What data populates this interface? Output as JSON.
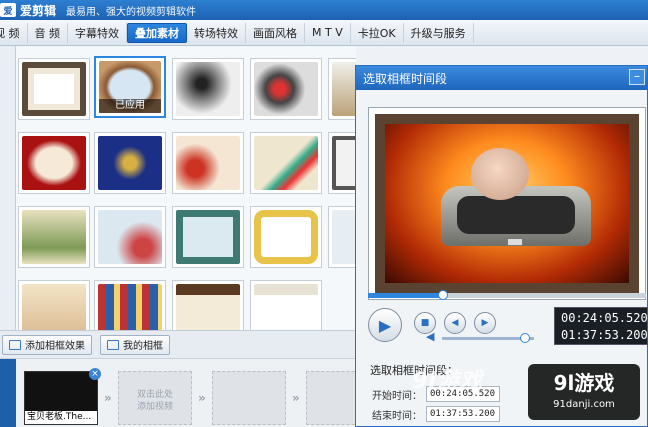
{
  "titlebar": {
    "app_name": "爱剪辑",
    "slogan": "最易用、强大的视频剪辑软件",
    "logo_text": "爱"
  },
  "menu": {
    "items": [
      "视 频",
      "音 频",
      "字幕特效",
      "叠加素材",
      "转场特效",
      "画面风格",
      "M T V",
      "卡拉OK",
      "升级与服务"
    ],
    "active": "叠加素材"
  },
  "thumbnails": {
    "applied_label": "已应用"
  },
  "actions": {
    "add_frame": "添加相框效果",
    "my_frames": "我的相框"
  },
  "timeline": {
    "clip_label": "宝贝老板.The...",
    "placeholder": "双击此处\n添加视频"
  },
  "dialog": {
    "title": "选取相框时间段",
    "current_time": "00:24:05.520",
    "total_time": "01:37:53.200",
    "section_title": "选取相框时间段：",
    "start_label": "开始时间：",
    "start_value": "00:24:05.520",
    "end_label": "结束时间：",
    "end_value": "01:37:53.200",
    "playback_progress": 0.27,
    "volume_level": 0.9
  },
  "watermark": {
    "text": "9l游戏",
    "logo_big": "9l游戏",
    "logo_small": "91danji.com"
  },
  "colors": {
    "accent": "#2d86e0",
    "titlebar": "#1c62b4"
  }
}
